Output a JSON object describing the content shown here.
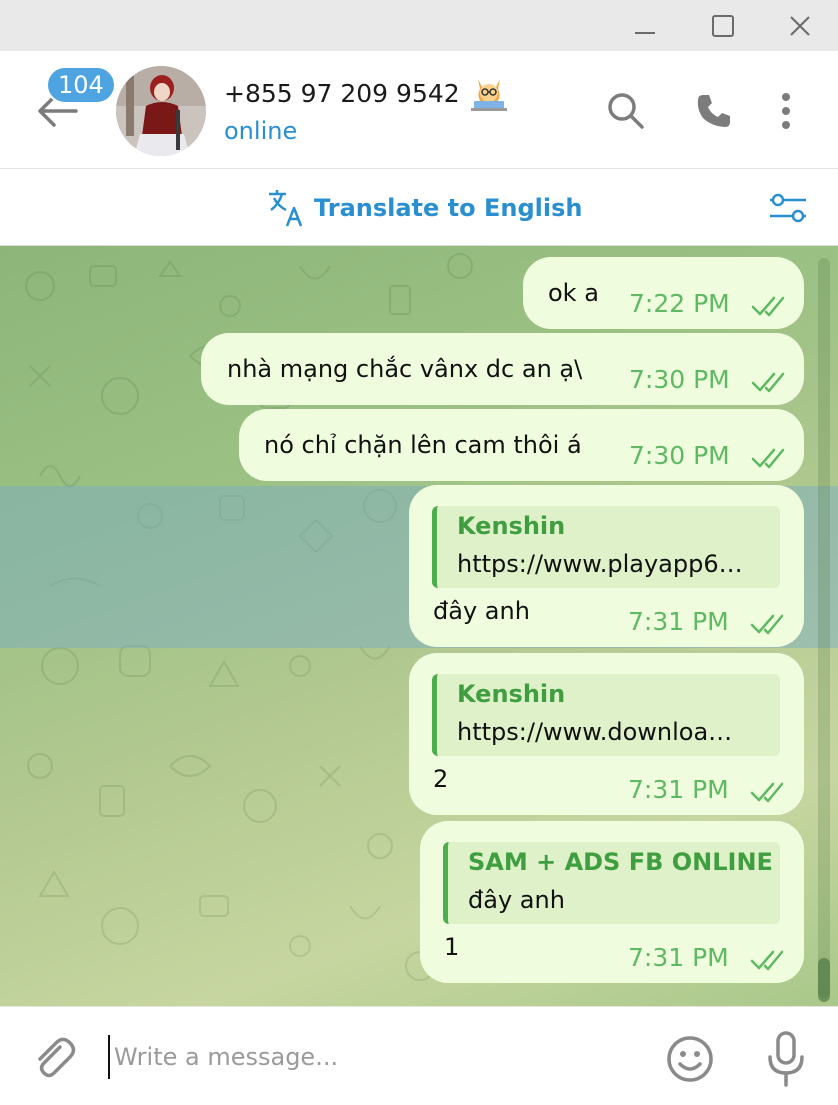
{
  "window": {
    "minimize_icon": "minimize-icon",
    "maximize_icon": "maximize-icon",
    "close_icon": "close-icon"
  },
  "header": {
    "unread_badge": "104",
    "contact_name": "+855 97 209 9542",
    "status": "online",
    "emoji_status_icon": "cat-at-laptop-icon"
  },
  "translate": {
    "label": "Translate to English"
  },
  "messages": [
    {
      "text": "ok a",
      "time": "7:22 PM"
    },
    {
      "text": "nhà mạng chắc vânx dc an ạ\\",
      "time": "7:30 PM"
    },
    {
      "text": "nó chỉ chặn lên cam thôi á",
      "time": "7:30 PM"
    },
    {
      "reply_author": "Kenshin",
      "reply_text": "https://www.playapp6…",
      "text": "đây anh",
      "time": "7:31 PM"
    },
    {
      "reply_author": "Kenshin",
      "reply_text": "https://www.downloa…",
      "text": "2",
      "time": "7:31 PM"
    },
    {
      "reply_author": "SAM + ADS FB ONLINE",
      "reply_text": "đây anh",
      "text": "1",
      "time": "7:31 PM"
    }
  ],
  "composer": {
    "placeholder": "Write a message..."
  },
  "colors": {
    "accent": "#2a8fd0",
    "badge": "#4ea4e0",
    "bubble_out": "#effdde",
    "time_green": "#5fb862",
    "quote_green": "#3f9e3f"
  }
}
